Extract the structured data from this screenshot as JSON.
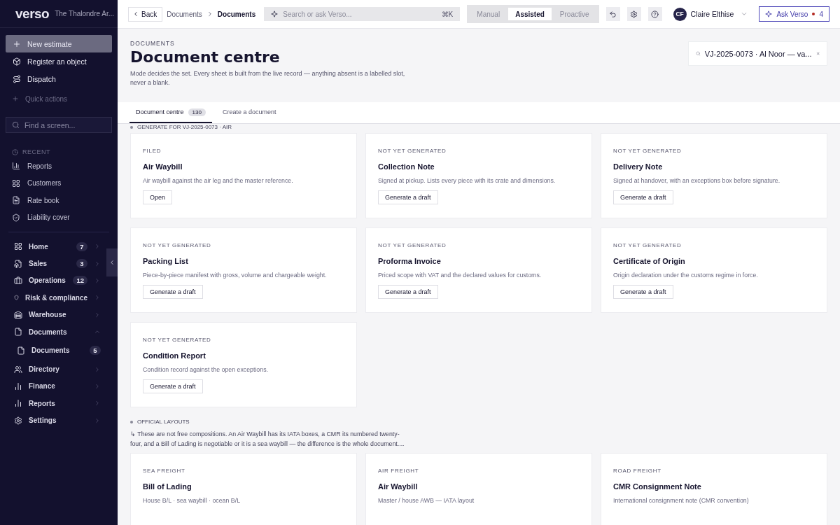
{
  "sidebar": {
    "logo": "verso",
    "org": "The Thalondre Ar...",
    "quick": [
      {
        "label": "New estimate",
        "selected": true
      },
      {
        "label": "Register an object",
        "selected": false
      },
      {
        "label": "Dispatch",
        "selected": false
      }
    ],
    "quick_actions": "Quick actions",
    "find": {
      "placeholder": "Find a screen..."
    },
    "recent_label": "RECENT",
    "recent": [
      "Reports",
      "Customers",
      "Rate book",
      "Liability cover"
    ],
    "nav": [
      {
        "label": "Home",
        "count": "7",
        "expanded": false
      },
      {
        "label": "Sales",
        "count": "3",
        "expanded": false
      },
      {
        "label": "Operations",
        "count": "12",
        "expanded": false
      },
      {
        "label": "Risk & compliance",
        "expanded": false
      },
      {
        "label": "Warehouse",
        "expanded": false
      },
      {
        "label": "Documents",
        "expanded": true,
        "children": [
          {
            "label": "Documents",
            "count": "5"
          }
        ]
      },
      {
        "label": "Directory",
        "expanded": false
      },
      {
        "label": "Finance",
        "expanded": false
      },
      {
        "label": "Reports",
        "expanded": false
      },
      {
        "label": "Settings",
        "expanded": false
      }
    ]
  },
  "topbar": {
    "back": "Back",
    "breadcrumbs": [
      "Documents",
      "Documents"
    ],
    "search": {
      "placeholder": "Search or ask Verso...",
      "shortcut": "⌘K"
    },
    "modes": [
      {
        "label": "Manual",
        "selected": false
      },
      {
        "label": "Assisted",
        "selected": true
      },
      {
        "label": "Proactive",
        "selected": false
      }
    ],
    "user": {
      "initials": "CF",
      "name": "Claire Elthise"
    },
    "ask": {
      "label": "Ask Verso",
      "count": "4"
    }
  },
  "header": {
    "eyebrow": "DOCUMENTS",
    "title": "Document centre",
    "description": "Mode decides the set. Every sheet is built from the live record — anything absent is a labelled slot, never a blank.",
    "record_search": {
      "value": "VJ-2025-0073 · Al Noor — va..."
    }
  },
  "tabs": [
    {
      "label": "Document centre",
      "count": "130",
      "selected": true
    },
    {
      "label": "Create a document",
      "selected": false
    }
  ],
  "generate": {
    "label": "GENERATE FOR VJ-2025-0073 · AIR",
    "cards": [
      {
        "status": "FILED",
        "title": "Air Waybill",
        "description": "Air waybill against the air leg and the master reference.",
        "action": "Open"
      },
      {
        "status": "NOT YET GENERATED",
        "title": "Collection Note",
        "description": "Signed at pickup. Lists every piece with its crate and dimensions.",
        "action": "Generate a draft"
      },
      {
        "status": "NOT YET GENERATED",
        "title": "Delivery Note",
        "description": "Signed at handover, with an exceptions box before signature.",
        "action": "Generate a draft"
      },
      {
        "status": "NOT YET GENERATED",
        "title": "Packing List",
        "description": "Piece-by-piece manifest with gross, volume and chargeable weight.",
        "action": "Generate a draft"
      },
      {
        "status": "NOT YET GENERATED",
        "title": "Proforma Invoice",
        "description": "Priced scope with VAT and the declared values for customs.",
        "action": "Generate a draft"
      },
      {
        "status": "NOT YET GENERATED",
        "title": "Certificate of Origin",
        "description": "Origin declaration under the customs regime in force.",
        "action": "Generate a draft"
      },
      {
        "status": "NOT YET GENERATED",
        "title": "Condition Report",
        "description": "Condition record against the open exceptions.",
        "action": "Generate a draft"
      }
    ]
  },
  "official": {
    "label": "OFFICIAL LAYOUTS",
    "note": "↳ These are not free compositions. An Air Waybill has its IATA boxes, a CMR its numbered twenty-four, and a Bill of Lading is negotiable or it is a sea waybill — the difference is the whole document....",
    "cards": [
      {
        "status": "SEA FREIGHT",
        "title": "Bill of Lading",
        "description": "House B/L · sea waybill · ocean B/L"
      },
      {
        "status": "AIR FREIGHT",
        "title": "Air Waybill",
        "description": "Master / house AWB — IATA layout"
      },
      {
        "status": "ROAD FREIGHT",
        "title": "CMR Consignment Note",
        "description": "International consignment note (CMR convention)"
      }
    ]
  }
}
